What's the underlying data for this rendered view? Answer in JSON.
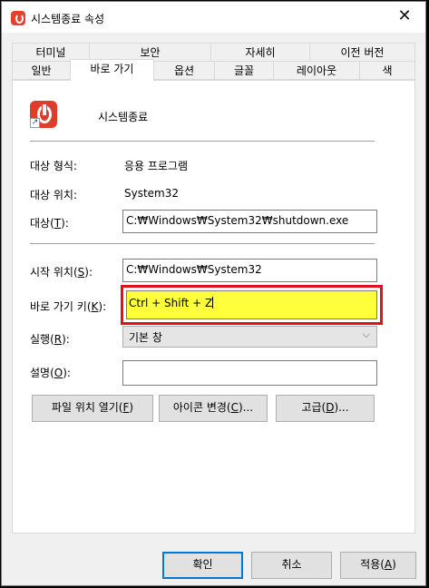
{
  "window": {
    "title": "시스템종료 속성",
    "close_glyph": "✕"
  },
  "tabs": {
    "row1": [
      "터미널",
      "보안",
      "자세히",
      "이전 버전"
    ],
    "row2": [
      "일반",
      "바로 가기",
      "옵션",
      "글꼴",
      "레이아웃",
      "색"
    ],
    "active": "바로 가기"
  },
  "shortcut": {
    "name": "시스템종료",
    "type_label": "대상 형식:",
    "type_value": "응용 프로그램",
    "location_label": "대상 위치:",
    "location_value": "System32",
    "target_label": "대상(",
    "target_key": "T",
    "target_label_end": "):",
    "target_value": "C:₩Windows₩System32₩shutdown.exe",
    "startin_label": "시작 위치(",
    "startin_key": "S",
    "startin_label_end": "):",
    "startin_value": "C:₩Windows₩System32",
    "hotkey_label": "바로 가기 키(",
    "hotkey_key": "K",
    "hotkey_label_end": "):",
    "hotkey_value": "Ctrl + Shift + Z",
    "run_label": "실행(",
    "run_key": "R",
    "run_label_end": "):",
    "run_value": "기본 창",
    "comment_label": "설명(",
    "comment_key": "O",
    "comment_label_end": "):",
    "comment_value": ""
  },
  "buttons": {
    "open_location": "파일 위치 열기(",
    "open_location_key": "F",
    "open_location_end": ")",
    "change_icon": "아이콘 변경(",
    "change_icon_key": "C",
    "change_icon_end": ")...",
    "advanced": "고급(",
    "advanced_key": "D",
    "advanced_end": ")...",
    "ok": "확인",
    "cancel": "취소",
    "apply": "적용(",
    "apply_key": "A",
    "apply_end": ")"
  },
  "colors": {
    "hotkey_highlight": "#ffff3c",
    "annotation_border": "#e0101c",
    "default_button_border": "#0078d7"
  },
  "icons": {
    "app": "power-shortcut-icon",
    "close": "close-icon",
    "dropdown": "chevron-down-icon"
  }
}
